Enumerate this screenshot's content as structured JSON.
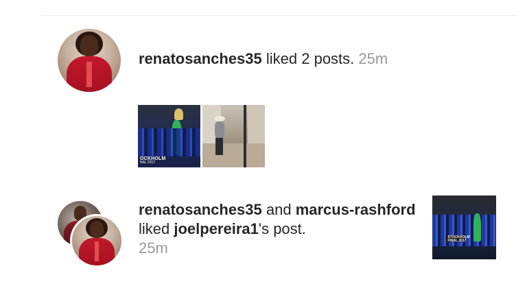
{
  "notifications": [
    {
      "username": "renatosanches35",
      "action_text": " liked 2 posts. ",
      "time": "25m",
      "thumbnails": [
        {
          "icon": "football-celebration-photo",
          "caption_line1": "OCKHOLM",
          "caption_line2": "NAL 2017"
        },
        {
          "icon": "street-photo"
        }
      ]
    },
    {
      "username": "renatosanches35",
      "connector": " and ",
      "second_username": "marcus-rashford",
      "action_text": " liked ",
      "target_username": "joelpereira1",
      "target_suffix": "'s post.",
      "time": "25m",
      "thumbnail": {
        "icon": "football-celebration-photo",
        "caption_line1": "STOCKHOLM",
        "caption_line2": "FINAL 2017"
      }
    }
  ],
  "colors": {
    "text": "#262626",
    "time": "#999999",
    "background": "#ffffff",
    "divider": "#ececec"
  }
}
